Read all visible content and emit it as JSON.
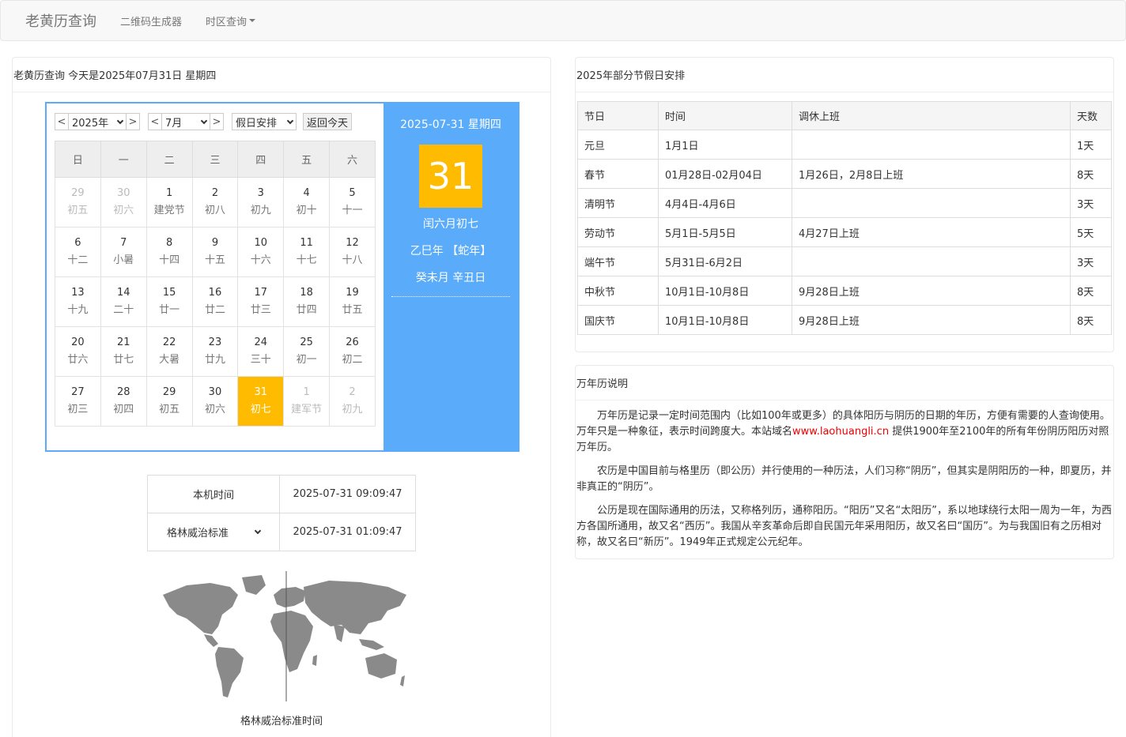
{
  "nav": {
    "brand": "老黄历查询",
    "items": [
      "二维码生成器",
      "时区查询"
    ]
  },
  "left": {
    "header": "老黄历查询 今天是2025年07月31日 星期四",
    "controls": {
      "prev": "<",
      "next": ">",
      "year": "2025年",
      "month": "7月",
      "holiday": "假日安排",
      "today_btn": "返回今天"
    },
    "weekdays": [
      "日",
      "一",
      "二",
      "三",
      "四",
      "五",
      "六"
    ],
    "weeks": [
      [
        [
          "29",
          "初五",
          "o"
        ],
        [
          "30",
          "初六",
          "o"
        ],
        [
          "1",
          "建党节",
          ""
        ],
        [
          "2",
          "初八",
          ""
        ],
        [
          "3",
          "初九",
          ""
        ],
        [
          "4",
          "初十",
          ""
        ],
        [
          "5",
          "十一",
          ""
        ]
      ],
      [
        [
          "6",
          "十二",
          ""
        ],
        [
          "7",
          "小暑",
          ""
        ],
        [
          "8",
          "十四",
          ""
        ],
        [
          "9",
          "十五",
          ""
        ],
        [
          "10",
          "十六",
          ""
        ],
        [
          "11",
          "十七",
          ""
        ],
        [
          "12",
          "十八",
          ""
        ]
      ],
      [
        [
          "13",
          "十九",
          ""
        ],
        [
          "14",
          "二十",
          ""
        ],
        [
          "15",
          "廿一",
          ""
        ],
        [
          "16",
          "廿二",
          ""
        ],
        [
          "17",
          "廿三",
          ""
        ],
        [
          "18",
          "廿四",
          ""
        ],
        [
          "19",
          "廿五",
          ""
        ]
      ],
      [
        [
          "20",
          "廿六",
          ""
        ],
        [
          "21",
          "廿七",
          ""
        ],
        [
          "22",
          "大暑",
          ""
        ],
        [
          "23",
          "廿九",
          ""
        ],
        [
          "24",
          "三十",
          ""
        ],
        [
          "25",
          "初一",
          ""
        ],
        [
          "26",
          "初二",
          ""
        ]
      ],
      [
        [
          "27",
          "初三",
          ""
        ],
        [
          "28",
          "初四",
          ""
        ],
        [
          "29",
          "初五",
          ""
        ],
        [
          "30",
          "初六",
          ""
        ],
        [
          "31",
          "初七",
          "t"
        ],
        [
          "1",
          "建军节",
          "o"
        ],
        [
          "2",
          "初九",
          "o"
        ]
      ]
    ],
    "side": {
      "date": "2025-07-31 星期四",
      "day": "31",
      "lunar": "闰六月初七",
      "ganzhi_year": "乙巳年 【蛇年】",
      "ganzhi_md": "癸未月 辛丑日"
    },
    "time": {
      "local_label": "本机时间",
      "local_value": "2025-07-31 09:09:47",
      "tz_label": "格林威治标准",
      "tz_value": "2025-07-31 01:09:47"
    },
    "map_caption": "格林威治标准时间",
    "colors": {
      "accent": "#5aabf9",
      "today": "#ffbb00"
    }
  },
  "holidays": {
    "header": "2025年部分节假日安排",
    "columns": [
      "节日",
      "时间",
      "调休上班",
      "天数"
    ],
    "rows": [
      [
        "元旦",
        "1月1日",
        "",
        "1天"
      ],
      [
        "春节",
        "01月28日-02月04日",
        "1月26日，2月8日上班",
        "8天"
      ],
      [
        "清明节",
        "4月4日-4月6日",
        "",
        "3天"
      ],
      [
        "劳动节",
        "5月1日-5月5日",
        "4月27日上班",
        "5天"
      ],
      [
        "端午节",
        "5月31日-6月2日",
        "",
        "3天"
      ],
      [
        "中秋节",
        "10月1日-10月8日",
        "9月28日上班",
        "8天"
      ],
      [
        "国庆节",
        "10月1日-10月8日",
        "9月28日上班",
        "8天"
      ]
    ]
  },
  "desc": {
    "header": "万年历说明",
    "p1_a": "万年历是记录一定时间范围内（比如100年或更多）的具体阳历与阴历的日期的年历，方便有需要的人查询使用。万年只是一种象征，表示时间跨度大。本站域名",
    "p1_link": "www.laohuangli.cn",
    "p1_b": " 提供1900年至2100年的所有年份阴历阳历对照万年历。",
    "p2": "农历是中国目前与格里历（即公历）并行使用的一种历法，人们习称“阴历”，但其实是阴阳历的一种，即夏历，并非真正的“阴历”。",
    "p3": "公历是现在国际通用的历法，又称格列历，通称阳历。“阳历”又名“太阳历”，系以地球绕行太阳一周为一年，为西方各国所通用，故又名“西历”。我国从辛亥革命后即自民国元年采用阳历，故又名曰“国历”。为与我国旧有之历相对称，故又名曰“新历”。1949年正式规定公元纪年。"
  }
}
